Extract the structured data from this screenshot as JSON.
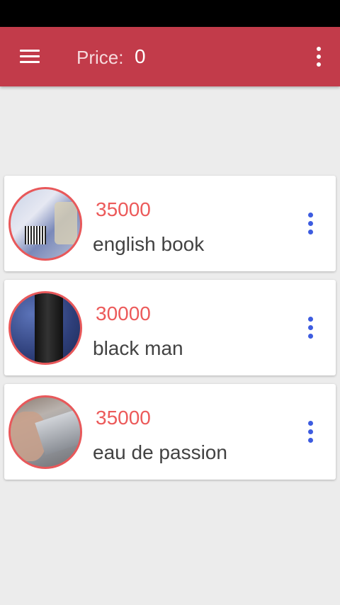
{
  "header": {
    "price_label": "Price:",
    "price_value": "0"
  },
  "items": [
    {
      "price": "35000",
      "name": "english book"
    },
    {
      "price": "30000",
      "name": "black man"
    },
    {
      "price": "35000",
      "name": "eau de passion"
    }
  ],
  "colors": {
    "app_bar": "#c23b4a",
    "price_text": "#ec5a5a",
    "item_menu_dots": "#3d5ce0",
    "avatar_border": "#e8585a"
  }
}
